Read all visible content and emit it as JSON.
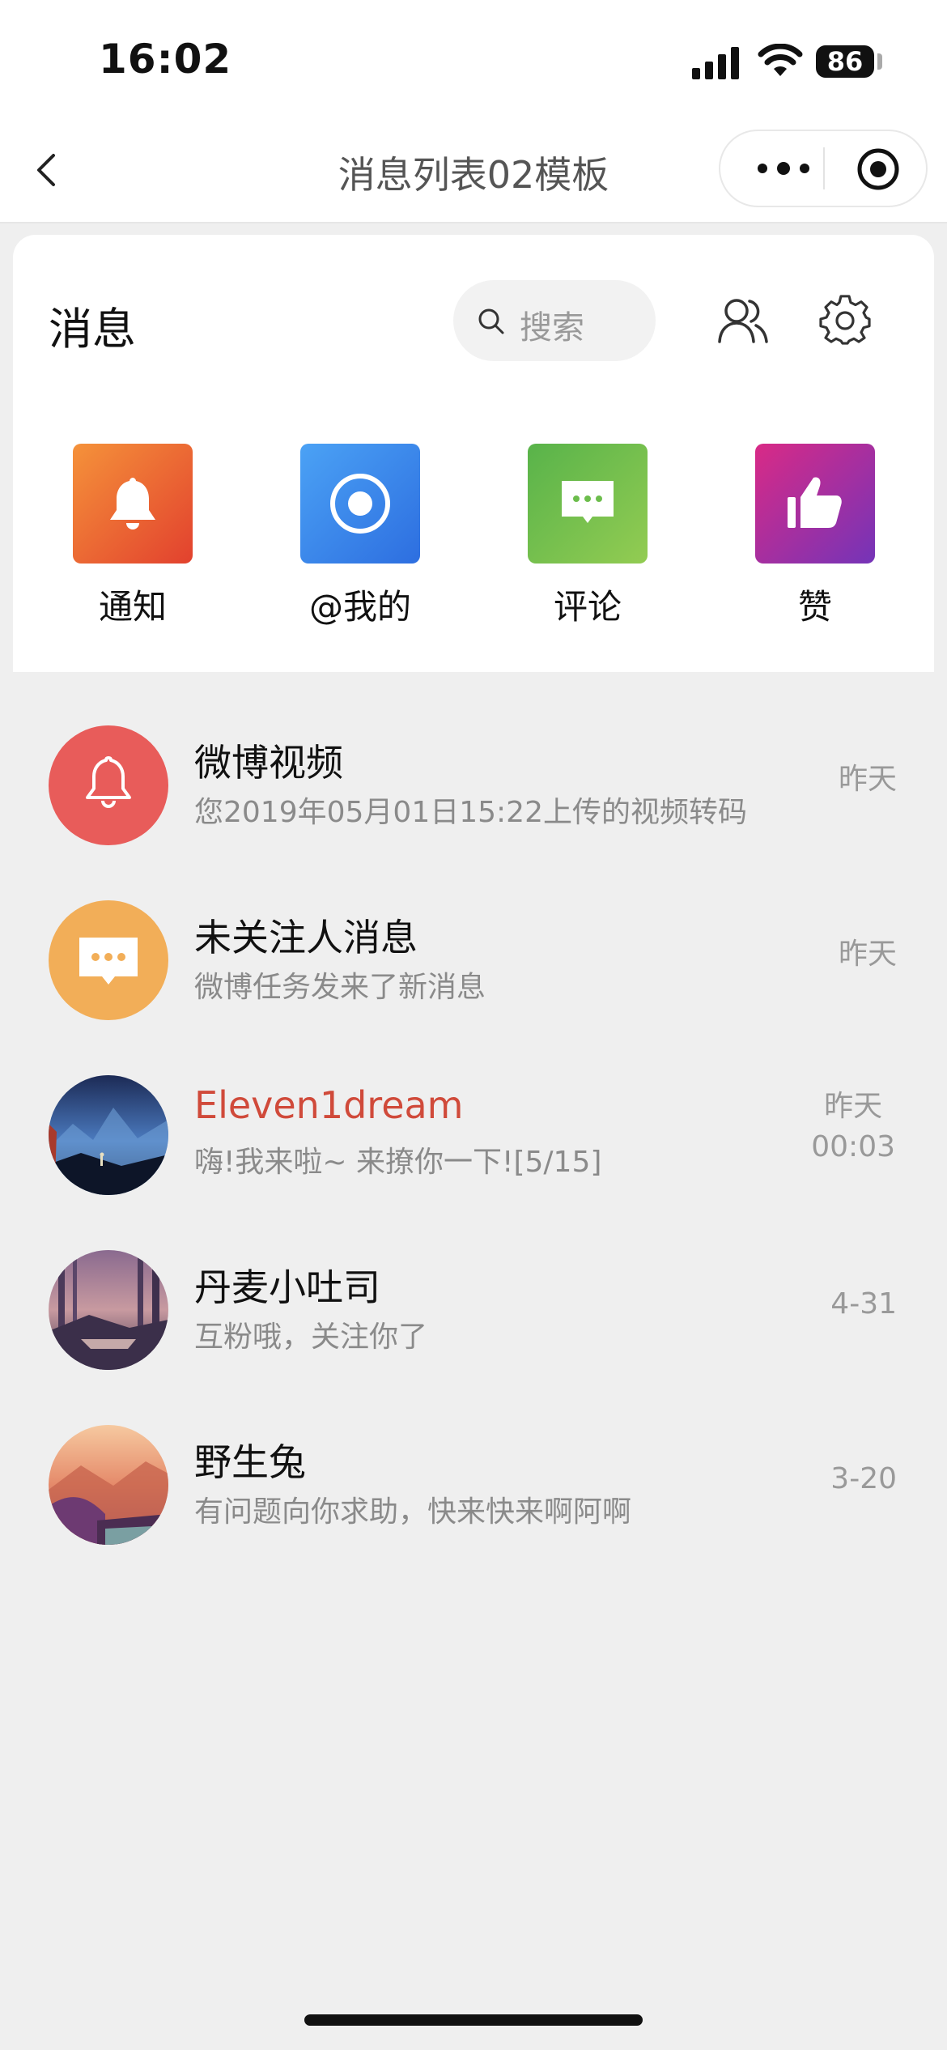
{
  "status_bar": {
    "time": "16:02",
    "battery": "86"
  },
  "nav": {
    "title": "消息列表02模板"
  },
  "header": {
    "title": "消息",
    "search_placeholder": "搜索"
  },
  "categories": [
    {
      "label": "通知",
      "icon": "bell-icon",
      "colors": [
        "#f08a34",
        "#e2412e"
      ]
    },
    {
      "label": "@我的",
      "icon": "at-target-icon",
      "colors": [
        "#4aa0f4",
        "#2f6fe0"
      ]
    },
    {
      "label": "评论",
      "icon": "comment-icon",
      "colors": [
        "#5fb84a",
        "#8ecb50"
      ]
    },
    {
      "label": "赞",
      "icon": "thumbs-up-icon",
      "colors": [
        "#d62b8a",
        "#7b34b8"
      ]
    }
  ],
  "messages": [
    {
      "name": "微博视频",
      "preview": "您2019年05月01日15:22上传的视频转码",
      "time": "昨天",
      "time2": "",
      "avatar": "bell-icon",
      "avatar_color": "#e85c5a"
    },
    {
      "name": "未关注人消息",
      "preview": "微博任务发来了新消息",
      "time": "昨天",
      "time2": "",
      "avatar": "comment-icon",
      "avatar_color": "#f2ae58"
    },
    {
      "name": "Eleven1dream",
      "preview": "嗨!我来啦~ 来撩你一下![5/15]",
      "time": "昨天",
      "time2": "00:03",
      "avatar": "night-landscape",
      "name_color": "#d04a3a"
    },
    {
      "name": "丹麦小吐司",
      "preview": "互粉哦，关注你了",
      "time": "4-31",
      "time2": "",
      "avatar": "forest-landscape"
    },
    {
      "name": "野生兔",
      "preview": "有问题向你求助，快来快来啊阿啊",
      "time": "3-20",
      "time2": "",
      "avatar": "sunset-landscape"
    }
  ]
}
